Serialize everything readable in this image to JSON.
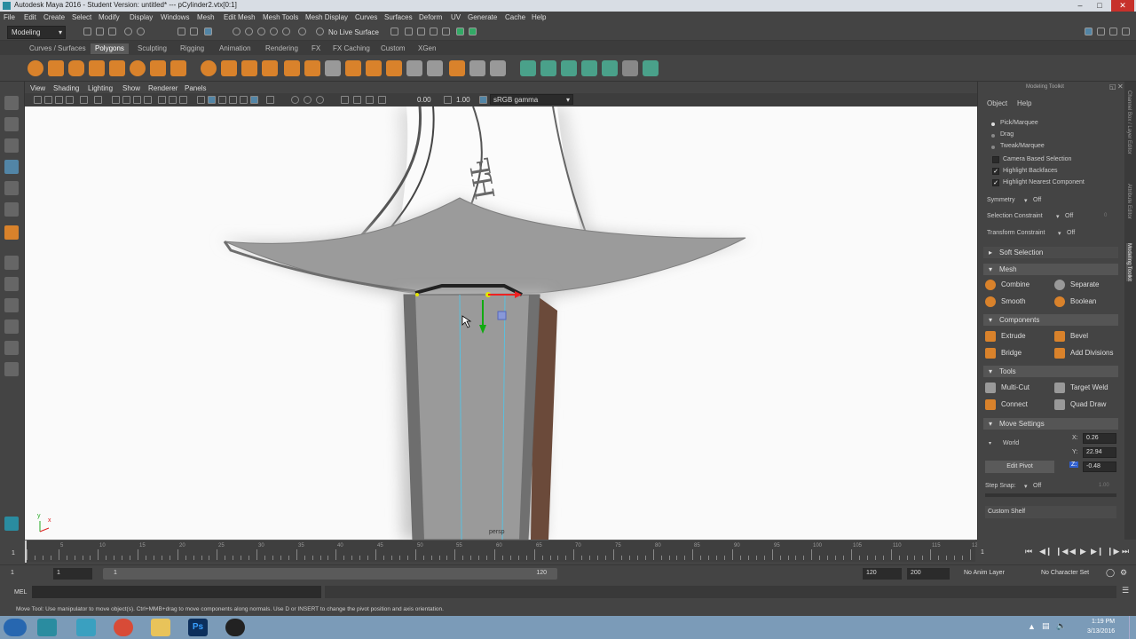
{
  "window": {
    "title": "Autodesk Maya 2016 - Student Version: untitled*   ---   pCylinder2.vtx[0:1]"
  },
  "menubar": {
    "items": [
      "File",
      "Edit",
      "Create",
      "Select",
      "Modify",
      "Display",
      "Windows",
      "Mesh",
      "Edit Mesh",
      "Mesh Tools",
      "Mesh Display",
      "Curves",
      "Surfaces",
      "Deform",
      "UV",
      "Generate",
      "Cache",
      "Help"
    ]
  },
  "statusline": {
    "mode": "Modeling",
    "live_surface": "No Live Surface"
  },
  "shelf_tabs": [
    "Curves / Surfaces",
    "Polygons",
    "Sculpting",
    "Rigging",
    "Animation",
    "Rendering",
    "FX",
    "FX Caching",
    "Custom",
    "XGen"
  ],
  "shelf_active_tab": "Polygons",
  "panel_menu": [
    "View",
    "Shading",
    "Lighting",
    "Show",
    "Renderer",
    "Panels"
  ],
  "panel_toolbar": {
    "field1": "0.00",
    "field2": "1.00",
    "colorspace": "sRGB gamma"
  },
  "viewport": {
    "camera_label": "persp",
    "axis_x": "x",
    "axis_y": "y"
  },
  "right_panel": {
    "title": "Modeling Toolkit",
    "menu": [
      "Object",
      "Help"
    ],
    "modes": [
      "Pick/Marquee",
      "Drag",
      "Tweak/Marquee"
    ],
    "checks": [
      {
        "label": "Camera Based Selection",
        "checked": false
      },
      {
        "label": "Highlight Backfaces",
        "checked": true
      },
      {
        "label": "Highlight Nearest Component",
        "checked": true
      }
    ],
    "symmetry_label": "Symmetry",
    "symmetry_value": "Off",
    "selection_constraint_label": "Selection Constraint",
    "selection_constraint_value": "Off",
    "selection_constraint_num": "0",
    "transform_constraint_label": "Transform Constraint",
    "transform_constraint_value": "Off",
    "soft_selection": "Soft Selection",
    "mesh_section": "Mesh",
    "mesh_buttons": [
      [
        "Combine",
        "Separate"
      ],
      [
        "Smooth",
        "Boolean"
      ]
    ],
    "components_section": "Components",
    "components_buttons": [
      [
        "Extrude",
        "Bevel"
      ],
      [
        "Bridge",
        "Add Divisions"
      ]
    ],
    "tools_section": "Tools",
    "tools_buttons": [
      [
        "Multi-Cut",
        "Target Weld"
      ],
      [
        "Connect",
        "Quad Draw"
      ]
    ],
    "move_section": "Move Settings",
    "space_label": "World",
    "x_label": "X:",
    "x_value": "0.26",
    "y_label": "Y:",
    "y_value": "22.94",
    "z_label": "Z:",
    "z_value": "-0.48",
    "edit_pivot": "Edit Pivot",
    "step_snap_label": "Step Snap:",
    "step_snap_value": "Off",
    "step_snap_num": "1.00",
    "custom_shelf": "Custom Shelf"
  },
  "side_tabs": [
    "Channel Box / Layer Editor",
    "Attribute Editor",
    "Modeling Toolkit"
  ],
  "timeline": {
    "ticks": [
      1,
      5,
      10,
      15,
      20,
      25,
      30,
      35,
      40,
      45,
      50,
      55,
      60,
      65,
      70,
      75,
      80,
      85,
      90,
      95,
      100,
      105,
      110,
      115,
      120
    ],
    "current_frame": "1",
    "field_left": "1"
  },
  "range": {
    "start": "1",
    "start2": "1",
    "range_start": "1",
    "range_end": "120",
    "end": "120",
    "end2": "200",
    "anim_layer": "No Anim Layer",
    "char_set": "No Character Set"
  },
  "mel": {
    "label": "MEL"
  },
  "help_line": "Move Tool: Use manipulator to move object(s). Ctrl+MMB+drag to move components along normals. Use D or INSERT to change the pivot position and axis orientation.",
  "taskbar": {
    "time": "1:19 PM",
    "date": "3/13/2016"
  },
  "colors": {
    "accent": "#5285a6",
    "viewport_bg": "#fafafa",
    "mesh_gray": "#9b9b9b",
    "maya_teal": "#2a8ca0"
  }
}
